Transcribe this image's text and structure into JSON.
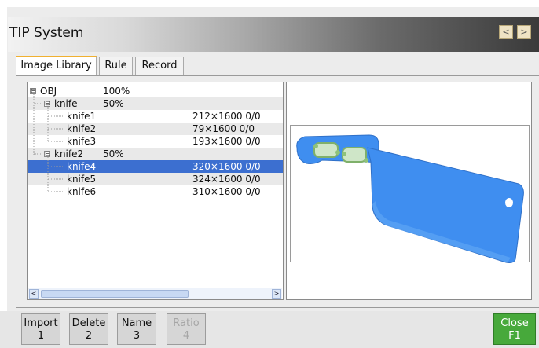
{
  "window": {
    "title": "TIP System"
  },
  "nav": {
    "prev": "<",
    "next": ">"
  },
  "tabs": [
    {
      "label": "Image Library",
      "active": true
    },
    {
      "label": "Rule",
      "active": false
    },
    {
      "label": "Record",
      "active": false
    }
  ],
  "tree": {
    "expander_open": "⊟",
    "rows": [
      {
        "name": "OBJ",
        "percent": "100%",
        "size": "",
        "level": 0,
        "expandable": true,
        "selected": false
      },
      {
        "name": "knife",
        "percent": "50%",
        "size": "",
        "level": 1,
        "expandable": true,
        "selected": false
      },
      {
        "name": "knife1",
        "percent": "",
        "size": "212×1600 0/0",
        "level": 2,
        "expandable": false,
        "selected": false
      },
      {
        "name": "knife2",
        "percent": "",
        "size": "79×1600   0/0",
        "level": 2,
        "expandable": false,
        "selected": false
      },
      {
        "name": "knife3",
        "percent": "",
        "size": "193×1600 0/0",
        "level": 2,
        "expandable": false,
        "selected": false
      },
      {
        "name": "knife2",
        "percent": "50%",
        "size": "",
        "level": 1,
        "expandable": true,
        "selected": false
      },
      {
        "name": "knife4",
        "percent": "",
        "size": "320×1600 0/0",
        "level": 2,
        "expandable": false,
        "selected": true
      },
      {
        "name": "knife5",
        "percent": "",
        "size": "324×1600 0/0",
        "level": 2,
        "expandable": false,
        "selected": false
      },
      {
        "name": "knife6",
        "percent": "",
        "size": "310×1600 0/0",
        "level": 2,
        "expandable": false,
        "selected": false
      }
    ]
  },
  "scrollbar": {
    "left": "<",
    "right": ">"
  },
  "preview": {
    "object": "cleaver-knife-xray",
    "color": "#3f8ef0"
  },
  "function_buttons": [
    {
      "label": "Import",
      "key": "1",
      "enabled": true
    },
    {
      "label": "Delete",
      "key": "2",
      "enabled": true
    },
    {
      "label": "Name",
      "key": "3",
      "enabled": true
    },
    {
      "label": "Ratio",
      "key": "4",
      "enabled": false
    }
  ],
  "close_button": {
    "label": "Close",
    "key": "F1",
    "color": "#47a93b"
  }
}
